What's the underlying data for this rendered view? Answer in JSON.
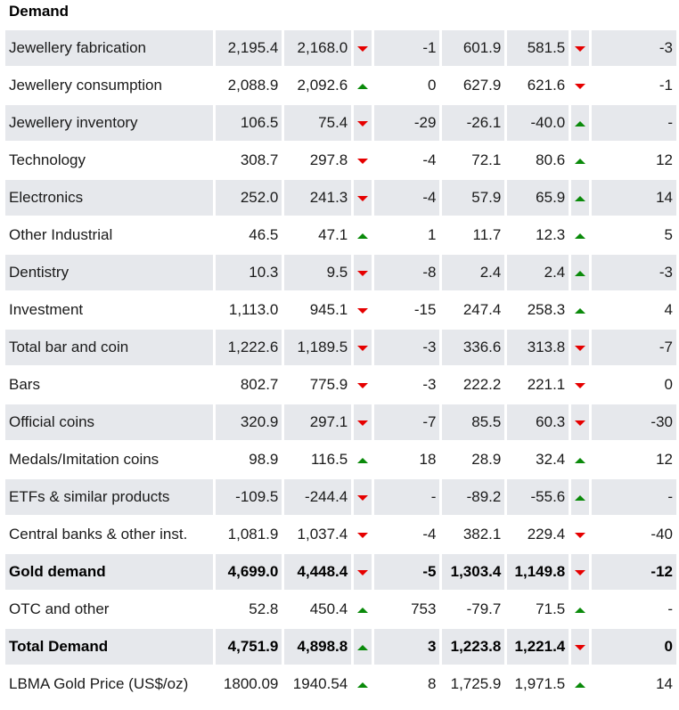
{
  "title": "Demand",
  "colors": {
    "up": "#0a8a0a",
    "down": "#e60000",
    "shade": "#e6e8ec"
  },
  "rows": [
    {
      "label": "Jewellery fabrication",
      "v1": "2,195.4",
      "v2": "2,168.0",
      "a1": "down",
      "c1": "-1",
      "v4": "601.9",
      "v5": "581.5",
      "a2": "down",
      "c2": "-3"
    },
    {
      "label": "Jewellery consumption",
      "v1": "2,088.9",
      "v2": "2,092.6",
      "a1": "up",
      "c1": "0",
      "v4": "627.9",
      "v5": "621.6",
      "a2": "down",
      "c2": "-1"
    },
    {
      "label": "Jewellery inventory",
      "v1": "106.5",
      "v2": "75.4",
      "a1": "down",
      "c1": "-29",
      "v4": "-26.1",
      "v5": "-40.0",
      "a2": "up",
      "c2": "-"
    },
    {
      "label": "Technology",
      "v1": "308.7",
      "v2": "297.8",
      "a1": "down",
      "c1": "-4",
      "v4": "72.1",
      "v5": "80.6",
      "a2": "up",
      "c2": "12"
    },
    {
      "label": "Electronics",
      "v1": "252.0",
      "v2": "241.3",
      "a1": "down",
      "c1": "-4",
      "v4": "57.9",
      "v5": "65.9",
      "a2": "up",
      "c2": "14"
    },
    {
      "label": "Other Industrial",
      "v1": "46.5",
      "v2": "47.1",
      "a1": "up",
      "c1": "1",
      "v4": "11.7",
      "v5": "12.3",
      "a2": "up",
      "c2": "5"
    },
    {
      "label": "Dentistry",
      "v1": "10.3",
      "v2": "9.5",
      "a1": "down",
      "c1": "-8",
      "v4": "2.4",
      "v5": "2.4",
      "a2": "up",
      "c2": "-3"
    },
    {
      "label": "Investment",
      "v1": "1,113.0",
      "v2": "945.1",
      "a1": "down",
      "c1": "-15",
      "v4": "247.4",
      "v5": "258.3",
      "a2": "up",
      "c2": "4"
    },
    {
      "label": "Total bar and coin",
      "v1": "1,222.6",
      "v2": "1,189.5",
      "a1": "down",
      "c1": "-3",
      "v4": "336.6",
      "v5": "313.8",
      "a2": "down",
      "c2": "-7"
    },
    {
      "label": "Bars",
      "v1": "802.7",
      "v2": "775.9",
      "a1": "down",
      "c1": "-3",
      "v4": "222.2",
      "v5": "221.1",
      "a2": "down",
      "c2": "0"
    },
    {
      "label": "Official coins",
      "v1": "320.9",
      "v2": "297.1",
      "a1": "down",
      "c1": "-7",
      "v4": "85.5",
      "v5": "60.3",
      "a2": "down",
      "c2": "-30"
    },
    {
      "label": "Medals/Imitation coins",
      "v1": "98.9",
      "v2": "116.5",
      "a1": "up",
      "c1": "18",
      "v4": "28.9",
      "v5": "32.4",
      "a2": "up",
      "c2": "12"
    },
    {
      "label": "ETFs & similar products",
      "v1": "-109.5",
      "v2": "-244.4",
      "a1": "down",
      "c1": "-",
      "v4": "-89.2",
      "v5": "-55.6",
      "a2": "up",
      "c2": "-"
    },
    {
      "label": "Central banks & other inst.",
      "v1": "1,081.9",
      "v2": "1,037.4",
      "a1": "down",
      "c1": "-4",
      "v4": "382.1",
      "v5": "229.4",
      "a2": "down",
      "c2": "-40"
    },
    {
      "label": "Gold demand",
      "bold": true,
      "v1": "4,699.0",
      "v2": "4,448.4",
      "a1": "down",
      "c1": "-5",
      "v4": "1,303.4",
      "v5": "1,149.8",
      "a2": "down",
      "c2": "-12"
    },
    {
      "label": "OTC and other",
      "v1": "52.8",
      "v2": "450.4",
      "a1": "up",
      "c1": "753",
      "v4": "-79.7",
      "v5": "71.5",
      "a2": "up",
      "c2": "-"
    },
    {
      "label": "Total Demand",
      "bold": true,
      "v1": "4,751.9",
      "v2": "4,898.8",
      "a1": "up",
      "c1": "3",
      "v4": "1,223.8",
      "v5": "1,221.4",
      "a2": "down",
      "c2": "0"
    },
    {
      "label": "LBMA Gold Price (US$/oz)",
      "v1": "1800.09",
      "v2": "1940.54",
      "a1": "up",
      "c1": "8",
      "v4": "1,725.9",
      "v5": "1,971.5",
      "a2": "up",
      "c2": "14"
    }
  ]
}
